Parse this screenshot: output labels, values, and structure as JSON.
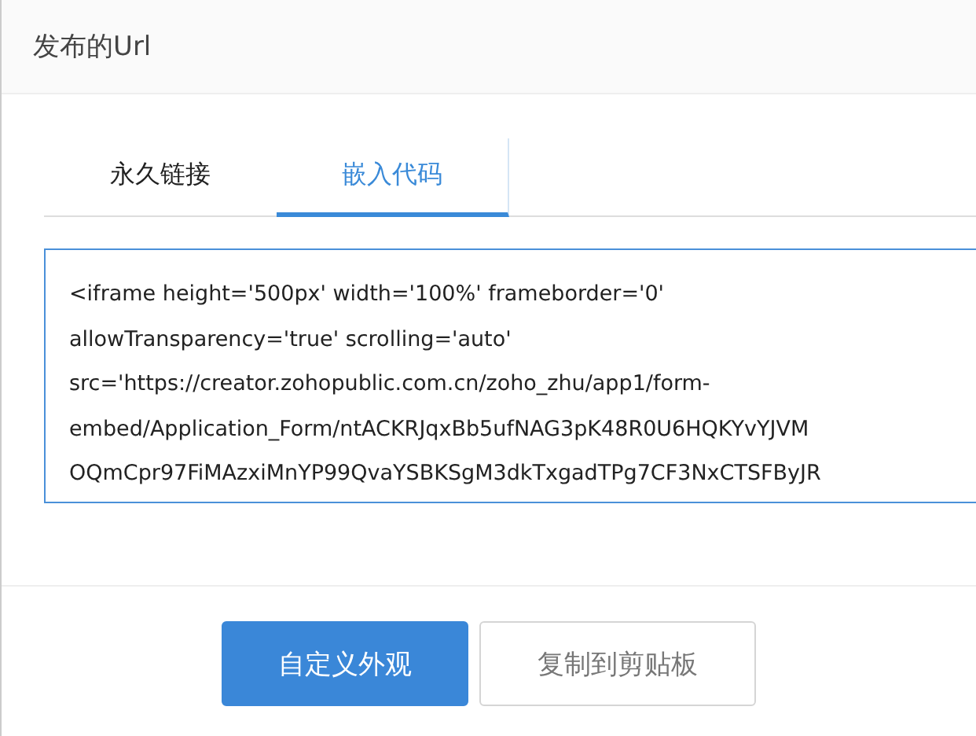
{
  "header": {
    "title": "发布的Url"
  },
  "tabs": [
    {
      "label": "永久链接",
      "selected": false
    },
    {
      "label": "嵌入代码",
      "selected": true
    }
  ],
  "code_box": {
    "lines": [
      "<iframe height='500px' width='100%' frameborder='0'",
      "allowTransparency='true' scrolling='auto'",
      "src='https://creator.zohopublic.com.cn/zoho_zhu/app1/form-",
      "embed/Application_Form/ntACKRJqxBb5ufNAG3pK48R0U6HQKYvYJVM",
      "OQmCpr97FiMAzxiMnYP99QvaYSBKSgM3dkTxgadTPg7CF3NxCTSFByJR"
    ]
  },
  "buttons": [
    {
      "label": "自定义外观",
      "kind": "primary"
    },
    {
      "label": "复制到剪贴板",
      "kind": "secondary"
    }
  ]
}
